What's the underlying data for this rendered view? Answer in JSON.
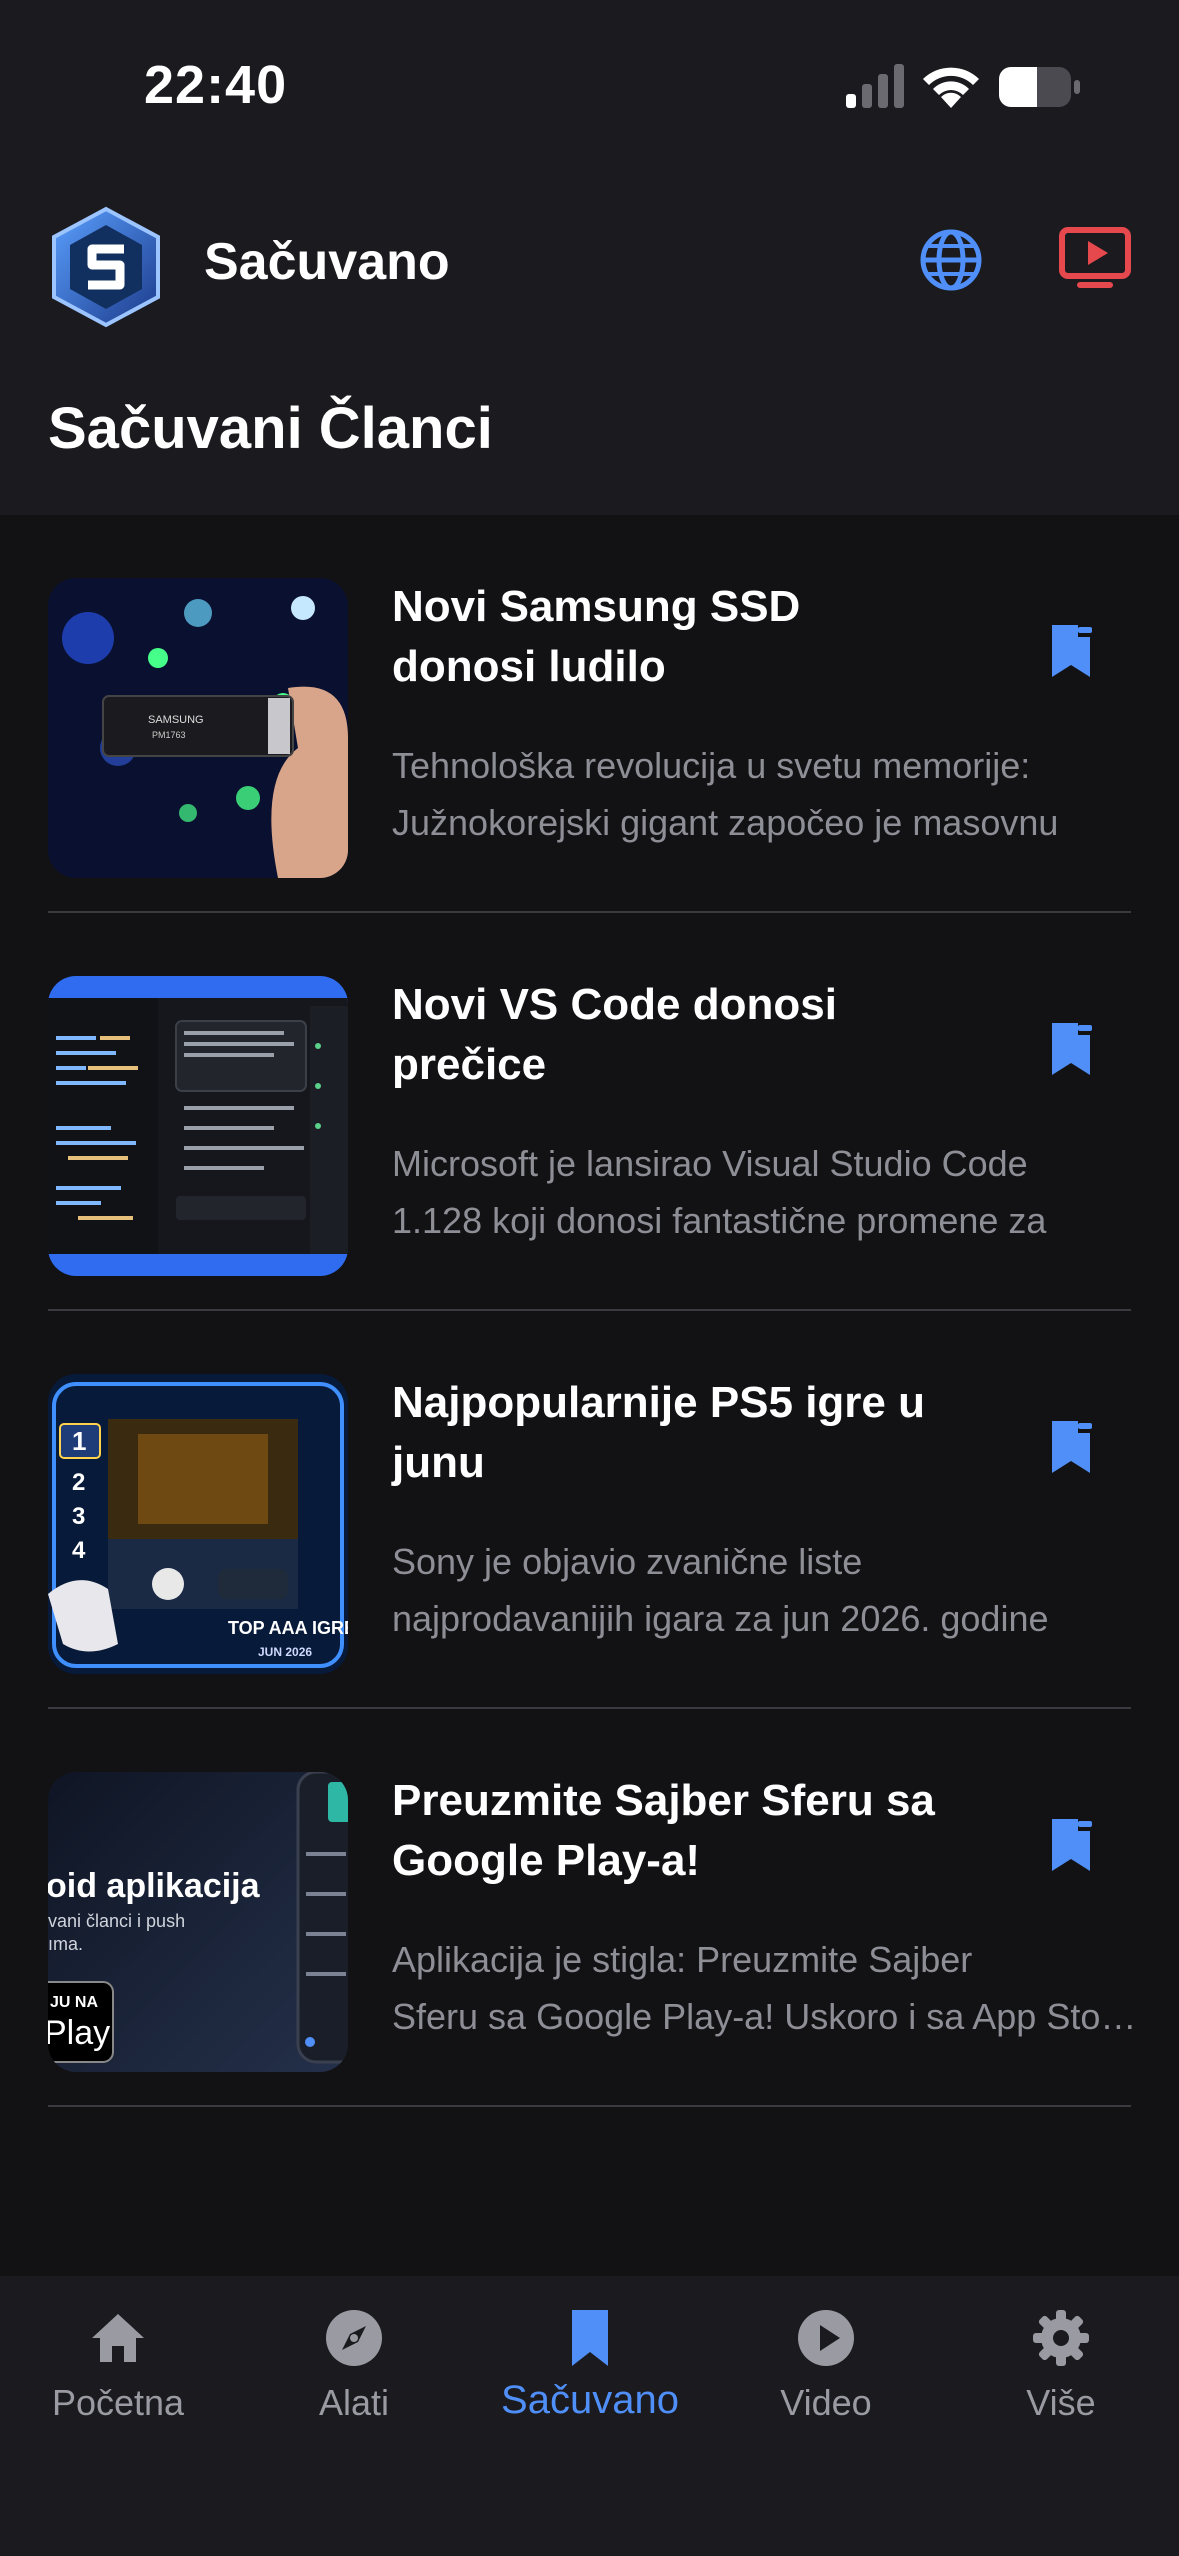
{
  "status_bar": {
    "time": "22:40"
  },
  "header": {
    "title": "Sačuvano",
    "section_title": "Sačuvani Članci"
  },
  "colors": {
    "accent": "#4f8ff7",
    "tv": "#e5484d",
    "background": "#121215",
    "surface": "#1a1a1f"
  },
  "articles": [
    {
      "title_line1": "Novi Samsung SSD",
      "title_line2": "donosi ludilo",
      "excerpt_line1": "Tehnološka revolucija u svetu memorije:",
      "excerpt_line2": "Južnokorejski gigant započeo je masovnu",
      "thumb_label1": "SAMSUNG",
      "thumb_label2": "PM1763"
    },
    {
      "title_line1": "Novi VS Code donosi",
      "title_line2": "prečice",
      "excerpt_line1": "Microsoft je lansirao Visual Studio Code",
      "excerpt_line2": "1.128 koji donosi fantastične promene za"
    },
    {
      "title_line1": "Najpopularnije PS5 igre u",
      "title_line2": "junu",
      "excerpt_line1": "Sony je objavio zvanične liste",
      "excerpt_line2": "najprodavanijih igara za jun 2026. godine",
      "thumb_ranks": [
        "1",
        "2",
        "3",
        "4"
      ],
      "thumb_label1": "TOP AAA IGRE",
      "thumb_label2": "JUN 2026"
    },
    {
      "title_line1": "Preuzmite Sajber Sferu sa",
      "title_line2": "Google Play-a!",
      "excerpt_line1": "Aplikacija je stigla: Preuzmite Sajber",
      "excerpt_line2": "Sferu sa Google Play-a! Uskoro i sa App Store-a",
      "thumb_label1": "oid aplikacija",
      "thumb_label2": "vani članci i push",
      "thumb_label3": "ıma.",
      "thumb_label4": "JU NA",
      "thumb_label5": "Play"
    }
  ],
  "tabs": [
    {
      "label": "Početna",
      "icon": "home-icon"
    },
    {
      "label": "Alati",
      "icon": "compass-icon"
    },
    {
      "label": "Sačuvano",
      "icon": "bookmark-icon",
      "active": true
    },
    {
      "label": "Video",
      "icon": "play-icon"
    },
    {
      "label": "Više",
      "icon": "gear-icon"
    }
  ]
}
